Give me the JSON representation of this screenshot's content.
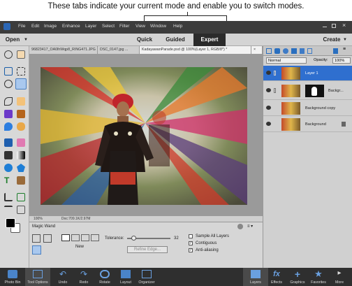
{
  "caption": "These tabs indicate your current mode and enable you to switch modes.",
  "menubar": {
    "items": [
      "File",
      "Edit",
      "Image",
      "Enhance",
      "Layer",
      "Select",
      "Filter",
      "View",
      "Window",
      "Help"
    ]
  },
  "modebar": {
    "open_label": "Open",
    "tabs": [
      "Quick",
      "Guided",
      "Expert"
    ],
    "create_label": "Create"
  },
  "doc_tabs": [
    "96823417_OA0lhWqp8_RING471.JPG",
    "DSC_0147.jpg ...",
    "KadayawanParade.psd @ 100%(Layer 1, RGB/8*) *"
  ],
  "status": {
    "zoom": "100%",
    "doc": "Doc:709.1K/2.97M"
  },
  "tool_options": {
    "tool_name": "Magic Wand",
    "new_label": "New",
    "tolerance_label": "Tolerance:",
    "tolerance_value": "32",
    "refine_label": "Refine Edge...",
    "sample_all": "Sample All Layers",
    "contiguous": "Contiguous",
    "antialias": "Anti-aliasing"
  },
  "layers_panel": {
    "blend_mode": "Normal",
    "opacity_label": "Opacity:",
    "opacity_value": "100%",
    "layers": [
      "Layer 1",
      "Backgr...",
      "Background copy",
      "Background"
    ]
  },
  "bottombar": {
    "left": [
      "Photo Bin",
      "Tool Options",
      "Undo",
      "Redo",
      "Rotate",
      "Layout",
      "Organizer"
    ],
    "right": [
      "Layers",
      "Effects",
      "Graphics",
      "Favorites",
      "More"
    ]
  },
  "colors": {
    "menubar": "#3c3c3c",
    "selection": "#2f6fcf",
    "bottombar": "#2f2f2f"
  }
}
